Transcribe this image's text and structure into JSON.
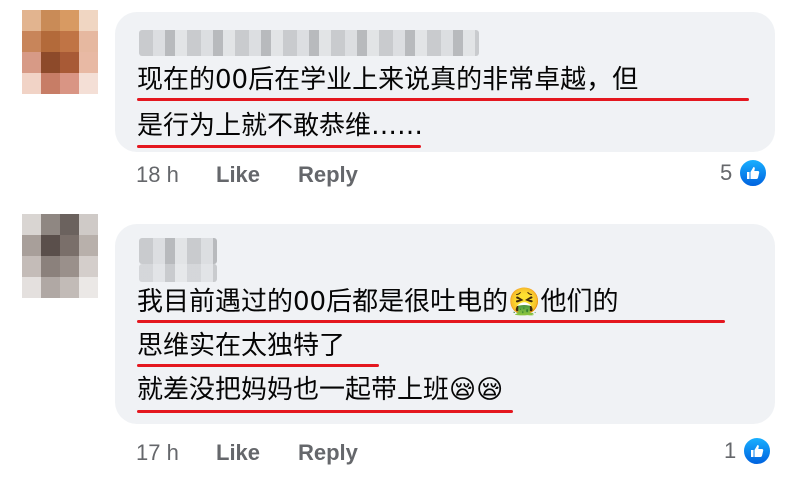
{
  "comments": [
    {
      "lines": [
        "现在的00后在学业上来说真的非常卓越，但",
        "是行为上就不敢恭维……"
      ],
      "time": "18 h",
      "like_label": "Like",
      "reply_label": "Reply",
      "reaction_count": "5"
    },
    {
      "line1_a": "我目前遇过的00后都是很吐电的",
      "line1_emoji": "🤮",
      "line1_b": "他们的",
      "line2": "思维实在太独特了",
      "line3": "就差没把妈妈也一起带上班",
      "line3_emoji": "😪😪",
      "time": "17 h",
      "like_label": "Like",
      "reply_label": "Reply",
      "reaction_count": "1"
    }
  ],
  "colors": {
    "bubble": "#f0f2f5",
    "underline": "#e4171f",
    "meta_text": "#65676b",
    "like_blue": "#1877f2"
  }
}
